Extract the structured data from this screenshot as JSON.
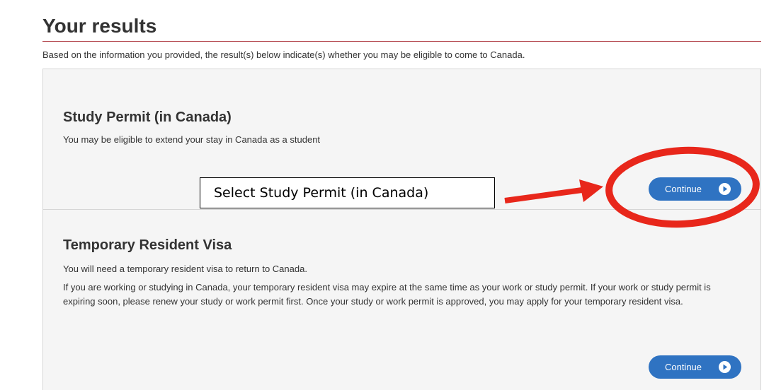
{
  "page": {
    "title": "Your results",
    "intro": "Based on the information you provided, the result(s) below indicate(s) whether you may be eligible to come to Canada."
  },
  "results": [
    {
      "title": "Study Permit (in Canada)",
      "paragraphs": [
        "You may be eligible to extend your stay in Canada as a student"
      ],
      "button_label": "Continue"
    },
    {
      "title": "Temporary Resident Visa",
      "paragraphs": [
        "You will need a temporary resident visa to return to Canada.",
        "If you are working or studying in Canada, your temporary resident visa may expire at the same time as your work or study permit. If your work or study permit is expiring soon, please renew your study or work permit first. Once your study or work permit is approved, you may apply for your temporary resident visa."
      ],
      "button_label": "Continue"
    }
  ],
  "annotation": {
    "callout_text": "Select Study Permit (in Canada)",
    "color": "#e8271b"
  },
  "colors": {
    "button": "#2f73c2",
    "title_rule": "#af3c43",
    "panel_background": "#f5f5f5"
  },
  "icons": {
    "button_icon": "play-circle-icon"
  }
}
